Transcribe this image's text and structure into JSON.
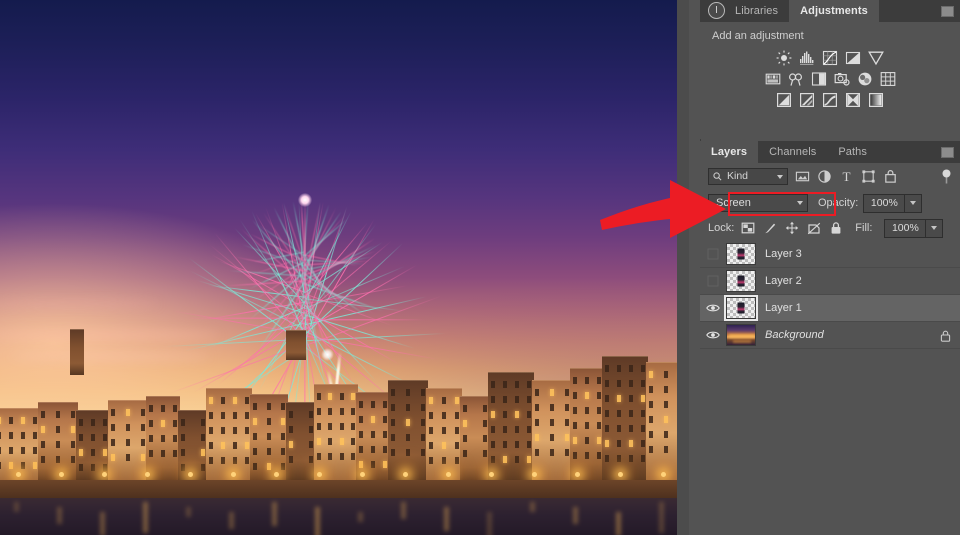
{
  "document": {
    "photo_description": "Fireworks over the Arno river in Pisa at dusk",
    "sky_colors": [
      "#141b4d",
      "#3e2d78",
      "#8d4c7c",
      "#cf8a73",
      "#f7dca8"
    ],
    "firework_colors": [
      "#7de8d8",
      "#ff6fae"
    ]
  },
  "annotation": {
    "arrow_color": "#ec1c24",
    "highlight_color": "#ec1c24",
    "target": "blend-mode-dropdown"
  },
  "dock": {
    "info_icon": "info-circle-icon",
    "adjustments_panel": {
      "tabs": [
        {
          "label": "Libraries",
          "active": false
        },
        {
          "label": "Adjustments",
          "active": true
        }
      ],
      "menu_icon": "panel-menu-icon",
      "title": "Add an adjustment",
      "rows": [
        [
          {
            "name": "brightness-contrast-icon",
            "label": "Brightness/Contrast"
          },
          {
            "name": "levels-icon",
            "label": "Levels"
          },
          {
            "name": "curves-icon",
            "label": "Curves"
          },
          {
            "name": "exposure-icon",
            "label": "Exposure"
          },
          {
            "name": "vibrance-icon",
            "label": "Vibrance"
          }
        ],
        [
          {
            "name": "hue-saturation-icon",
            "label": "Hue/Saturation"
          },
          {
            "name": "color-balance-icon",
            "label": "Color Balance"
          },
          {
            "name": "black-white-icon",
            "label": "Black & White"
          },
          {
            "name": "photo-filter-icon",
            "label": "Photo Filter"
          },
          {
            "name": "channel-mixer-icon",
            "label": "Channel Mixer"
          },
          {
            "name": "color-lookup-icon",
            "label": "Color Lookup"
          }
        ],
        [
          {
            "name": "invert-icon",
            "label": "Invert"
          },
          {
            "name": "posterize-icon",
            "label": "Posterize"
          },
          {
            "name": "threshold-icon",
            "label": "Threshold"
          },
          {
            "name": "selective-color-icon",
            "label": "Selective Color"
          },
          {
            "name": "gradient-map-icon",
            "label": "Gradient Map"
          }
        ]
      ]
    },
    "layers_panel": {
      "tabs": [
        {
          "label": "Layers",
          "active": true
        },
        {
          "label": "Channels",
          "active": false
        },
        {
          "label": "Paths",
          "active": false
        }
      ],
      "menu_icon": "panel-menu-icon",
      "filter": {
        "search_icon": "search-icon",
        "kind_value": "Kind",
        "icons": [
          {
            "name": "filter-pixel-icon",
            "label": "Pixel layers"
          },
          {
            "name": "filter-adjustment-icon",
            "label": "Adjustment layers"
          },
          {
            "name": "filter-type-icon",
            "label": "Type layers"
          },
          {
            "name": "filter-shape-icon",
            "label": "Shape layers"
          },
          {
            "name": "filter-smart-object-icon",
            "label": "Smart objects"
          }
        ],
        "toggle_icon": "filter-power-toggle-icon"
      },
      "blend": {
        "mode_value": "Screen",
        "opacity_label": "Opacity:",
        "opacity_value": "100%"
      },
      "lock": {
        "label": "Lock:",
        "icons": [
          {
            "name": "lock-transparent-pixels-icon",
            "label": "Lock transparent pixels"
          },
          {
            "name": "lock-image-pixels-icon",
            "label": "Lock image pixels"
          },
          {
            "name": "lock-position-icon",
            "label": "Lock position"
          },
          {
            "name": "lock-artboard-nesting-icon",
            "label": "Prevent auto-nesting"
          },
          {
            "name": "lock-all-icon",
            "label": "Lock all"
          }
        ],
        "fill_label": "Fill:",
        "fill_value": "100%"
      },
      "layers": [
        {
          "name": "Layer 3",
          "visible": false,
          "selected": false,
          "locked": false,
          "italic": false,
          "thumb": "transparent-firework"
        },
        {
          "name": "Layer 2",
          "visible": false,
          "selected": false,
          "locked": false,
          "italic": false,
          "thumb": "transparent-firework"
        },
        {
          "name": "Layer 1",
          "visible": true,
          "selected": true,
          "locked": false,
          "italic": false,
          "thumb": "transparent-firework"
        },
        {
          "name": "Background",
          "visible": true,
          "selected": false,
          "locked": true,
          "italic": true,
          "thumb": "photo"
        }
      ]
    }
  }
}
